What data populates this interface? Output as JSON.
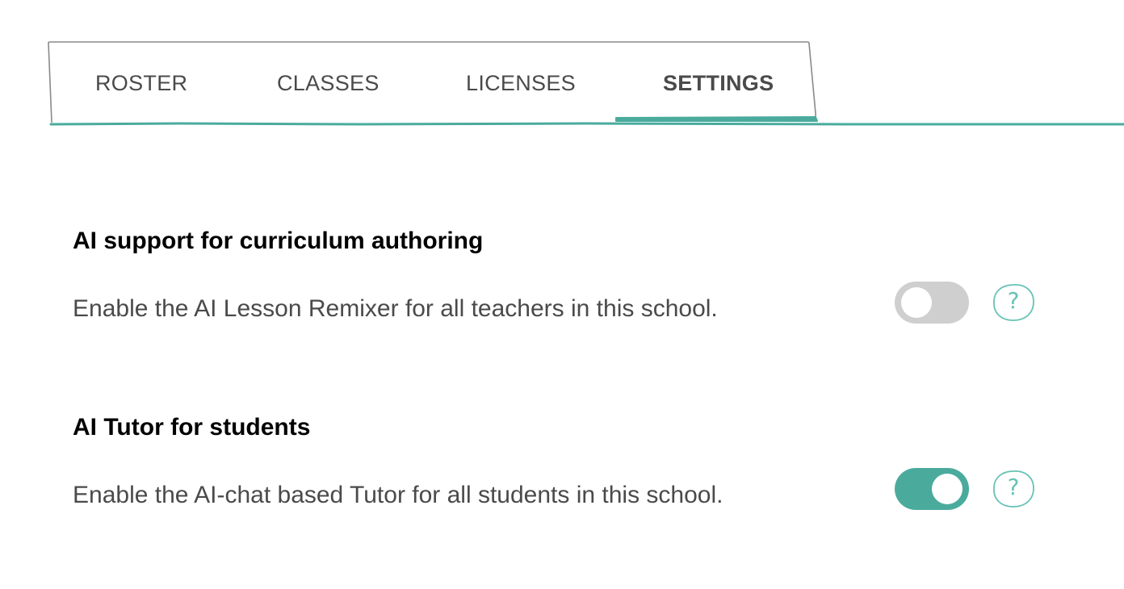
{
  "tabs": [
    {
      "label": "ROSTER",
      "active": false
    },
    {
      "label": "CLASSES",
      "active": false
    },
    {
      "label": "LICENSES",
      "active": false
    },
    {
      "label": "SETTINGS",
      "active": true
    }
  ],
  "colors": {
    "accent": "#4aab9d",
    "toggle_off": "#cfcfcf",
    "help_icon": "#67c2b6",
    "title_text": "#000000",
    "body_text": "#4a4a4a"
  },
  "settings": [
    {
      "title": "AI support for curriculum authoring",
      "description": "Enable the AI Lesson Remixer for all teachers in this school.",
      "enabled": false,
      "help_icon": "question-mark-icon",
      "help_glyph": "?"
    },
    {
      "title": "AI Tutor for students",
      "description": "Enable the AI-chat based Tutor for all students in this school.",
      "enabled": true,
      "help_icon": "question-mark-icon",
      "help_glyph": "?"
    }
  ]
}
